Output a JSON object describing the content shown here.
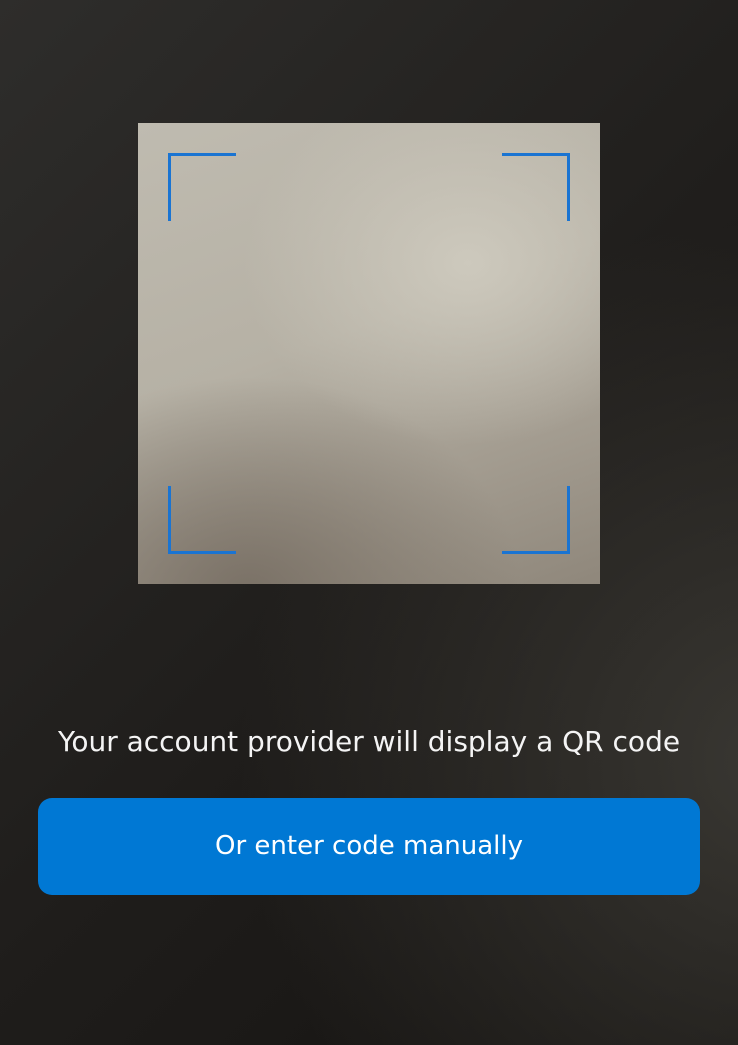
{
  "scanner": {
    "viewfinder_color": "#1a74d2"
  },
  "instruction_text": "Your account provider will display a QR code",
  "manual_button": {
    "label": "Or enter code manually",
    "color": "#0078d4"
  }
}
